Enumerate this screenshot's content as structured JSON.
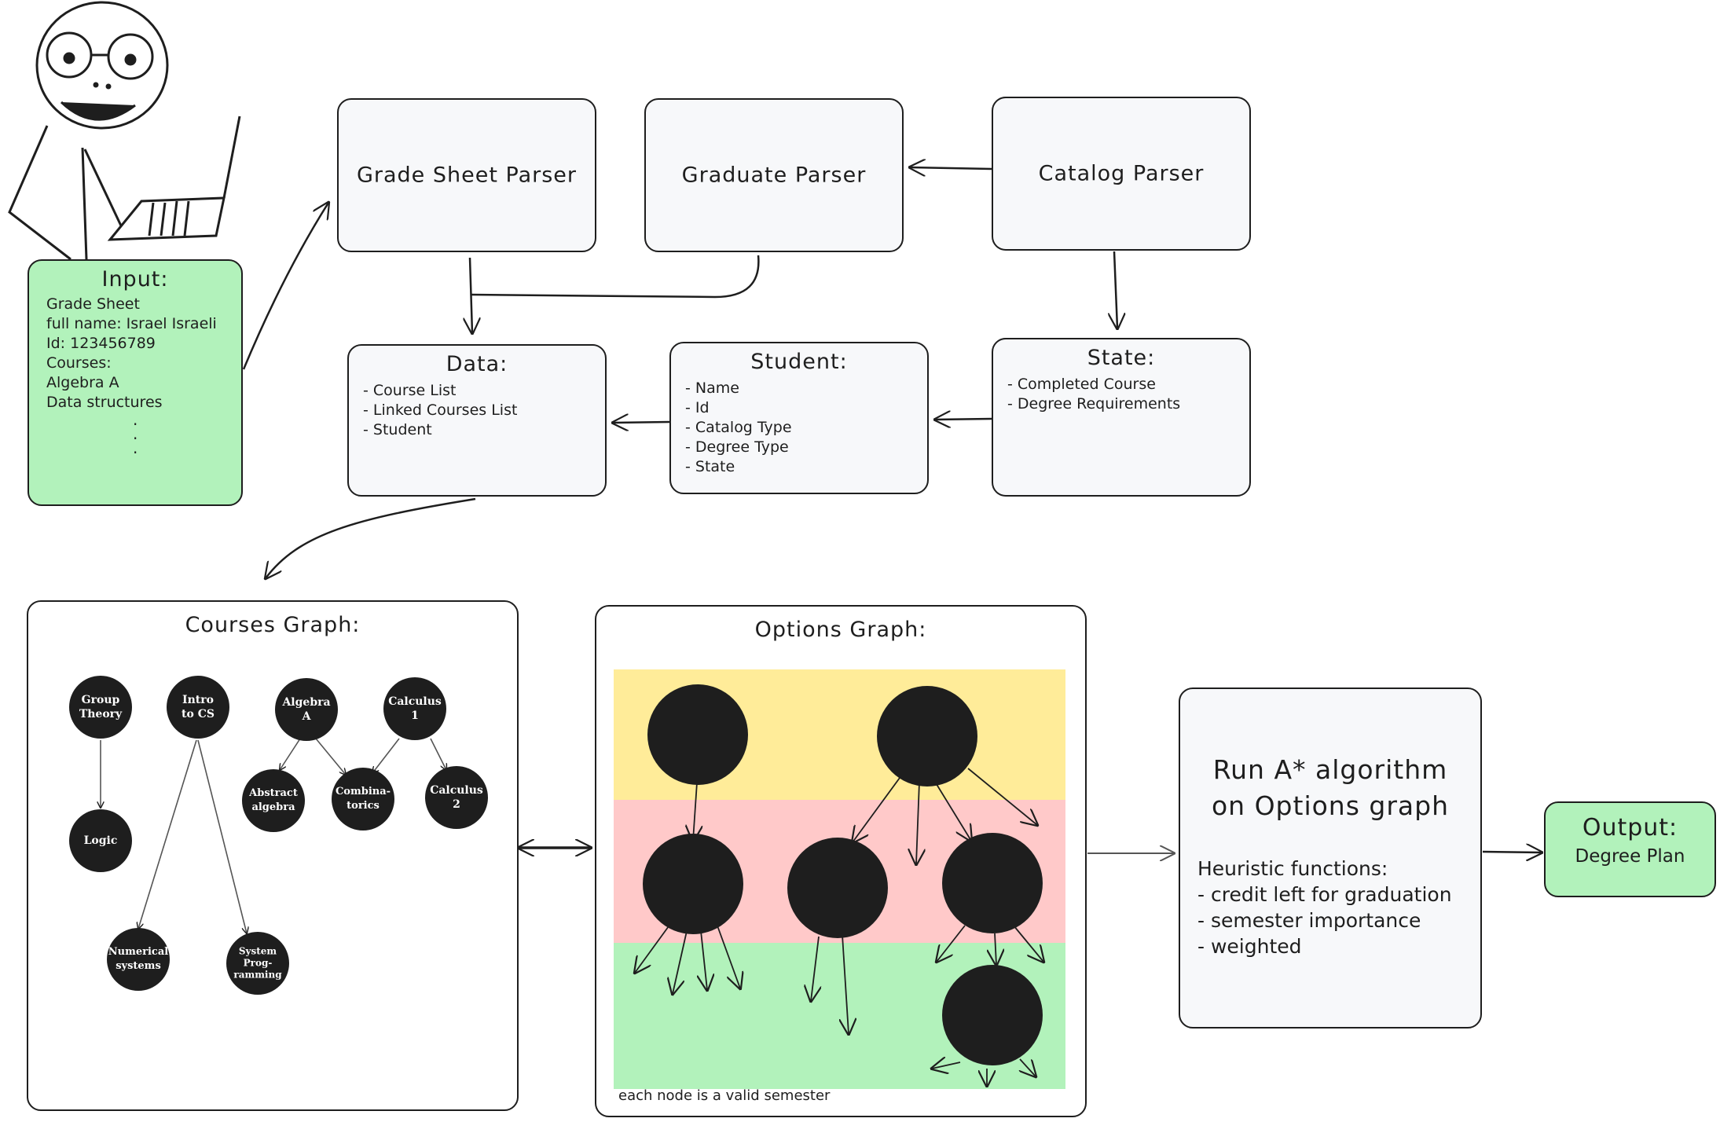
{
  "input": {
    "title": "Input:",
    "lines": [
      "Grade Sheet",
      "full name: Israel Israeli",
      "Id: 123456789",
      "Courses:",
      "Algebra A",
      "Data structures"
    ],
    "dots": [
      ".",
      ".",
      "."
    ]
  },
  "parsers": {
    "grade_sheet": "Grade Sheet Parser",
    "graduate": "Graduate Parser",
    "catalog": "Catalog Parser"
  },
  "data_box": {
    "title": "Data:",
    "items": [
      "Course List",
      "Linked Courses List",
      "Student"
    ]
  },
  "student_box": {
    "title": "Student:",
    "items": [
      "Name",
      "Id",
      "Catalog Type",
      "Degree Type",
      "State"
    ]
  },
  "state_box": {
    "title": "State:",
    "items": [
      "Completed Course",
      "Degree Requirements"
    ]
  },
  "courses_graph": {
    "title": "Courses Graph:",
    "nodes": {
      "group_theory": "Group\nTheory",
      "intro_cs": "Intro\nto CS",
      "algebra_a": "Algebra\nA",
      "calculus_1": "Calculus\n1",
      "logic": "Logic",
      "abstract_algebra": "Abstract\nalgebra",
      "combinatorics": "Combina-\ntorics",
      "calculus_2": "Calculus\n2",
      "numerical_systems": "Numerical\nsystems",
      "system_programming": "System\nProg-\nramming"
    }
  },
  "options_graph": {
    "title": "Options Graph:",
    "caption": "each node is a valid semester",
    "band_colors": [
      "#ffec99",
      "#ffc9c9",
      "#b2f2bb"
    ]
  },
  "astar": {
    "title_line1": "Run A* algorithm",
    "title_line2": "on Options graph",
    "heuristic_title": "Heuristic functions:",
    "heuristics": [
      "- credit left for graduation",
      "- semester importance",
      "- weighted"
    ]
  },
  "output": {
    "title": "Output:",
    "value": "Degree Plan"
  }
}
